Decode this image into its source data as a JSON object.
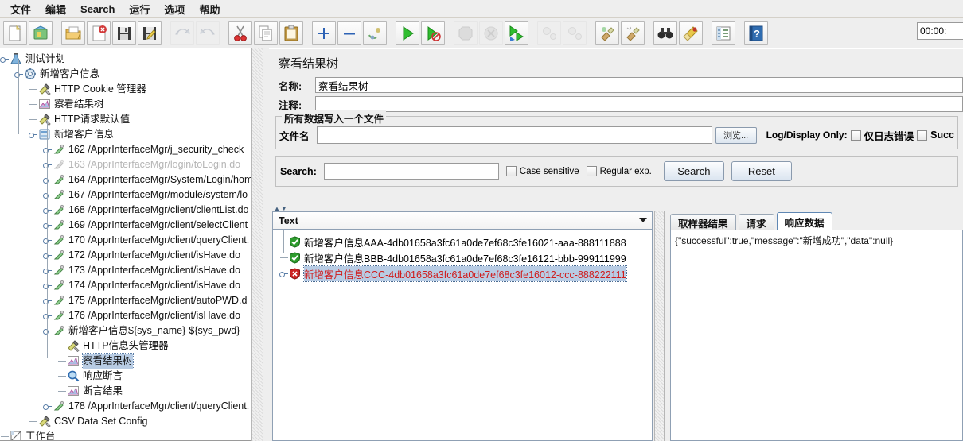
{
  "menu": {
    "items": [
      {
        "label": "文件",
        "name": "menu-file"
      },
      {
        "label": "编辑",
        "name": "menu-edit"
      },
      {
        "label": "Search",
        "name": "menu-search"
      },
      {
        "label": "运行",
        "name": "menu-run"
      },
      {
        "label": "选项",
        "name": "menu-options"
      },
      {
        "label": "帮助",
        "name": "menu-help"
      }
    ]
  },
  "toolbar": {
    "timer": "00:00:",
    "buttons": [
      {
        "name": "new-icon",
        "icon": "new"
      },
      {
        "name": "templates-icon",
        "icon": "templates"
      },
      {
        "name": "open-icon",
        "icon": "open"
      },
      {
        "name": "close-icon",
        "icon": "close"
      },
      {
        "name": "save-icon",
        "icon": "save"
      },
      {
        "name": "save-as-icon",
        "icon": "saveas"
      },
      {
        "name": "undo-icon",
        "icon": "undo",
        "disabled": true
      },
      {
        "name": "redo-icon",
        "icon": "redo",
        "disabled": true
      },
      {
        "name": "cut-icon",
        "icon": "cut"
      },
      {
        "name": "copy-icon",
        "icon": "copy"
      },
      {
        "name": "paste-icon",
        "icon": "paste"
      },
      {
        "name": "expand-all-icon",
        "icon": "plus"
      },
      {
        "name": "collapse-all-icon",
        "icon": "minus"
      },
      {
        "name": "toggle-icon",
        "icon": "toggle"
      },
      {
        "name": "start-icon",
        "icon": "start"
      },
      {
        "name": "start-no-pause-icon",
        "icon": "startnopause"
      },
      {
        "name": "stop-icon",
        "icon": "stop",
        "disabled": true
      },
      {
        "name": "shutdown-icon",
        "icon": "shutdown",
        "disabled": true
      },
      {
        "name": "start-remote-all-icon",
        "icon": "remotestart"
      },
      {
        "name": "stop-remote-all-icon",
        "icon": "remotestop",
        "disabled": true
      },
      {
        "name": "shutdown-remote-all-icon",
        "icon": "remoteshutdown",
        "disabled": true
      },
      {
        "name": "clear-icon",
        "icon": "clear"
      },
      {
        "name": "clear-all-icon",
        "icon": "clearall"
      },
      {
        "name": "search-icon",
        "icon": "binoculars"
      },
      {
        "name": "search-reset-icon",
        "icon": "brush"
      },
      {
        "name": "function-helper-icon",
        "icon": "list"
      },
      {
        "name": "help-icon",
        "icon": "help"
      }
    ]
  },
  "tree": {
    "nodes": [
      {
        "label": "测试计划",
        "icon": "testplan",
        "depth": 0,
        "handle": "expanded",
        "dim": false,
        "selected": false
      },
      {
        "label": "新增客户信息",
        "icon": "threadgroup",
        "depth": 1,
        "handle": "expanded",
        "dim": false,
        "selected": false
      },
      {
        "label": "HTTP Cookie 管理器",
        "icon": "config",
        "depth": 2,
        "handle": "leaf",
        "dim": false,
        "selected": false
      },
      {
        "label": "察看结果树",
        "icon": "listener",
        "depth": 2,
        "handle": "leaf",
        "dim": false,
        "selected": false
      },
      {
        "label": "HTTP请求默认值",
        "icon": "config",
        "depth": 2,
        "handle": "leaf",
        "dim": false,
        "selected": false
      },
      {
        "label": "新增客户信息",
        "icon": "controller",
        "depth": 2,
        "handle": "expanded",
        "dim": false,
        "selected": false
      },
      {
        "label": "162 /ApprInterfaceMgr/j_security_check",
        "icon": "sampler",
        "depth": 3,
        "handle": "collapsed",
        "dim": false,
        "selected": false
      },
      {
        "label": "163 /ApprInterfaceMgr/login/toLogin.do",
        "icon": "sampler-dim",
        "depth": 3,
        "handle": "collapsed",
        "dim": true,
        "selected": false
      },
      {
        "label": "164 /ApprInterfaceMgr/System/Login/hom",
        "icon": "sampler",
        "depth": 3,
        "handle": "collapsed",
        "dim": false,
        "selected": false
      },
      {
        "label": "167 /ApprInterfaceMgr/module/system/lo",
        "icon": "sampler",
        "depth": 3,
        "handle": "collapsed",
        "dim": false,
        "selected": false
      },
      {
        "label": "168 /ApprInterfaceMgr/client/clientList.do",
        "icon": "sampler",
        "depth": 3,
        "handle": "collapsed",
        "dim": false,
        "selected": false
      },
      {
        "label": "169 /ApprInterfaceMgr/client/selectClient",
        "icon": "sampler",
        "depth": 3,
        "handle": "collapsed",
        "dim": false,
        "selected": false
      },
      {
        "label": "170 /ApprInterfaceMgr/client/queryClient.",
        "icon": "sampler",
        "depth": 3,
        "handle": "collapsed",
        "dim": false,
        "selected": false
      },
      {
        "label": "172 /ApprInterfaceMgr/client/isHave.do",
        "icon": "sampler",
        "depth": 3,
        "handle": "collapsed",
        "dim": false,
        "selected": false
      },
      {
        "label": "173 /ApprInterfaceMgr/client/isHave.do",
        "icon": "sampler",
        "depth": 3,
        "handle": "collapsed",
        "dim": false,
        "selected": false
      },
      {
        "label": "174 /ApprInterfaceMgr/client/isHave.do",
        "icon": "sampler",
        "depth": 3,
        "handle": "collapsed",
        "dim": false,
        "selected": false
      },
      {
        "label": "175 /ApprInterfaceMgr/client/autoPWD.d",
        "icon": "sampler",
        "depth": 3,
        "handle": "collapsed",
        "dim": false,
        "selected": false
      },
      {
        "label": "176 /ApprInterfaceMgr/client/isHave.do",
        "icon": "sampler",
        "depth": 3,
        "handle": "collapsed",
        "dim": false,
        "selected": false
      },
      {
        "label": "新增客户信息${sys_name}-${sys_pwd}-",
        "icon": "sampler",
        "depth": 3,
        "handle": "expanded",
        "dim": false,
        "selected": false
      },
      {
        "label": "HTTP信息头管理器",
        "icon": "config",
        "depth": 4,
        "handle": "leaf",
        "dim": false,
        "selected": false
      },
      {
        "label": "察看结果树",
        "icon": "listener",
        "depth": 4,
        "handle": "leaf",
        "dim": false,
        "selected": true
      },
      {
        "label": "响应断言",
        "icon": "assertion",
        "depth": 4,
        "handle": "leaf",
        "dim": false,
        "selected": false
      },
      {
        "label": "断言结果",
        "icon": "listener",
        "depth": 4,
        "handle": "leaf",
        "dim": false,
        "selected": false
      },
      {
        "label": "178 /ApprInterfaceMgr/client/queryClient.",
        "icon": "sampler",
        "depth": 3,
        "handle": "collapsed",
        "dim": false,
        "selected": false
      },
      {
        "label": "CSV Data Set Config",
        "icon": "config",
        "depth": 2,
        "handle": "leaf",
        "dim": false,
        "selected": false
      },
      {
        "label": "工作台",
        "icon": "workbench",
        "depth": 0,
        "handle": "leaf",
        "dim": false,
        "selected": false
      }
    ]
  },
  "panel": {
    "title": "察看结果树",
    "name_label": "名称:",
    "name_value": "察看结果树",
    "comment_label": "注释:",
    "comment_value": "",
    "file_group_title": "所有数据写入一个文件",
    "filename_label": "文件名",
    "filename_value": "",
    "browse_label": "浏览...",
    "log_display_label": "Log/Display Only:",
    "errors_only_label": "仅日志错误",
    "successes_only_label": "Succ"
  },
  "search": {
    "label": "Search:",
    "value": "",
    "case_sensitive_label": "Case sensitive",
    "regular_exp_label": "Regular exp.",
    "search_button": "Search",
    "reset_button": "Reset"
  },
  "results": {
    "combo_value": "Text",
    "rows": [
      {
        "label": "新增客户信息AAA-4db01658a3fc61a0de7ef68c3fe16021-aaa-888111888",
        "status": "success",
        "selected": false,
        "handle": "leaf"
      },
      {
        "label": "新增客户信息BBB-4db01658a3fc61a0de7ef68c3fe16121-bbb-999111999",
        "status": "success",
        "selected": false,
        "handle": "leaf"
      },
      {
        "label": "新增客户信息CCC-4db01658a3fc61a0de7ef68c3fe16012-ccc-888222111",
        "status": "error",
        "selected": true,
        "handle": "expandable"
      }
    ],
    "tabs": [
      {
        "label": "取样器结果",
        "active": false
      },
      {
        "label": "请求",
        "active": false
      },
      {
        "label": "响应数据",
        "active": true
      }
    ],
    "response_text": "{\"successful\":true,\"message\":\"新增成功\",\"data\":null}"
  },
  "colors": {
    "success": "#2d9c2d",
    "error": "#cc2222",
    "selection": "#b8cce4",
    "error_text": "#d01c1c",
    "background": "#eeeeee"
  }
}
